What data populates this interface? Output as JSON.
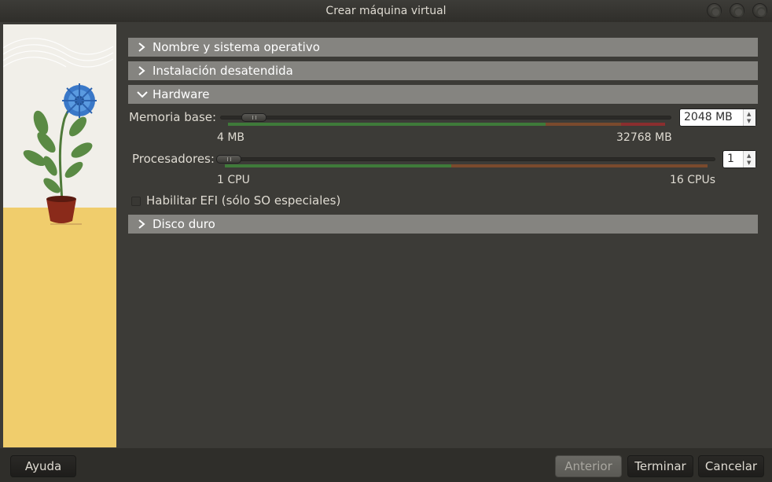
{
  "window": {
    "title": "Crear máquina virtual"
  },
  "sections": {
    "name_os": "Nombre y sistema operativo",
    "unattended": "Instalación desatendida",
    "hardware": "Hardware",
    "hard_disk": "Disco duro"
  },
  "hardware": {
    "memory": {
      "label": "Memoria base:",
      "value": "2048 MB",
      "value_mb": 2048,
      "min_label": "4 MB",
      "max_label": "32768 MB"
    },
    "processors": {
      "label": "Procesadores:",
      "value": "1",
      "min_label": "1 CPU",
      "max_label": "16 CPUs"
    },
    "efi": {
      "label": "Habilitar EFI (sólo SO especiales)",
      "checked": false
    }
  },
  "buttons": {
    "help": "Ayuda",
    "back": "Anterior",
    "finish": "Terminar",
    "cancel": "Cancelar"
  },
  "colors": {
    "ok": "#3f7a3a",
    "warn": "#7a4a2d",
    "bad": "#8a2e2e"
  }
}
